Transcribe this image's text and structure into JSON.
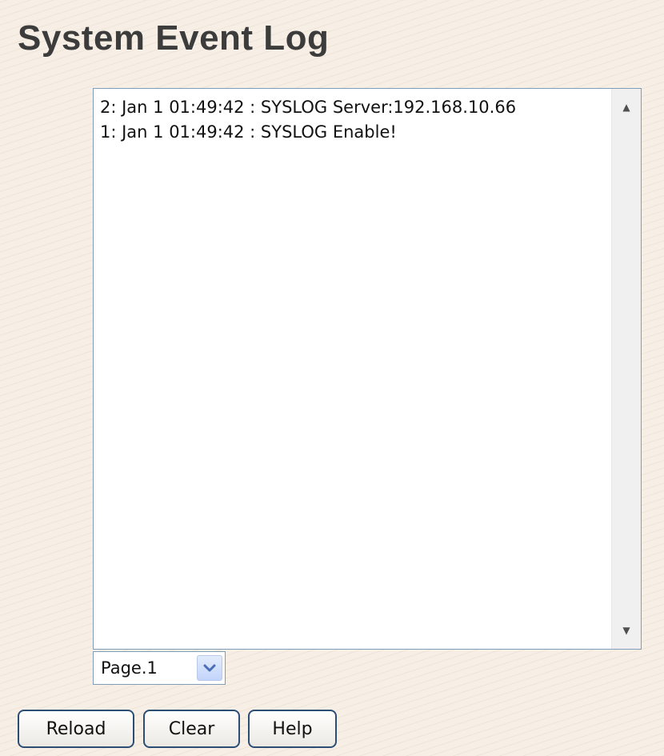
{
  "header": {
    "title": "System Event Log"
  },
  "log": {
    "lines": [
      "2: Jan 1 01:49:42 : SYSLOG Server:192.168.10.66",
      "1: Jan 1 01:49:42 : SYSLOG Enable!"
    ]
  },
  "scrollbar": {
    "up_icon": "scroll-up-arrow",
    "down_icon": "scroll-down-arrow"
  },
  "page_select": {
    "selected": "Page.1",
    "icon": "chevron-down-icon"
  },
  "buttons": {
    "reload": "Reload",
    "clear": "Clear",
    "help": "Help"
  },
  "colors": {
    "background": "#f7efe5",
    "title": "#3c3c3c",
    "border": "#7f9db9",
    "button_border": "#2c4e74",
    "dropdown_accent": "#4a6fb5"
  }
}
